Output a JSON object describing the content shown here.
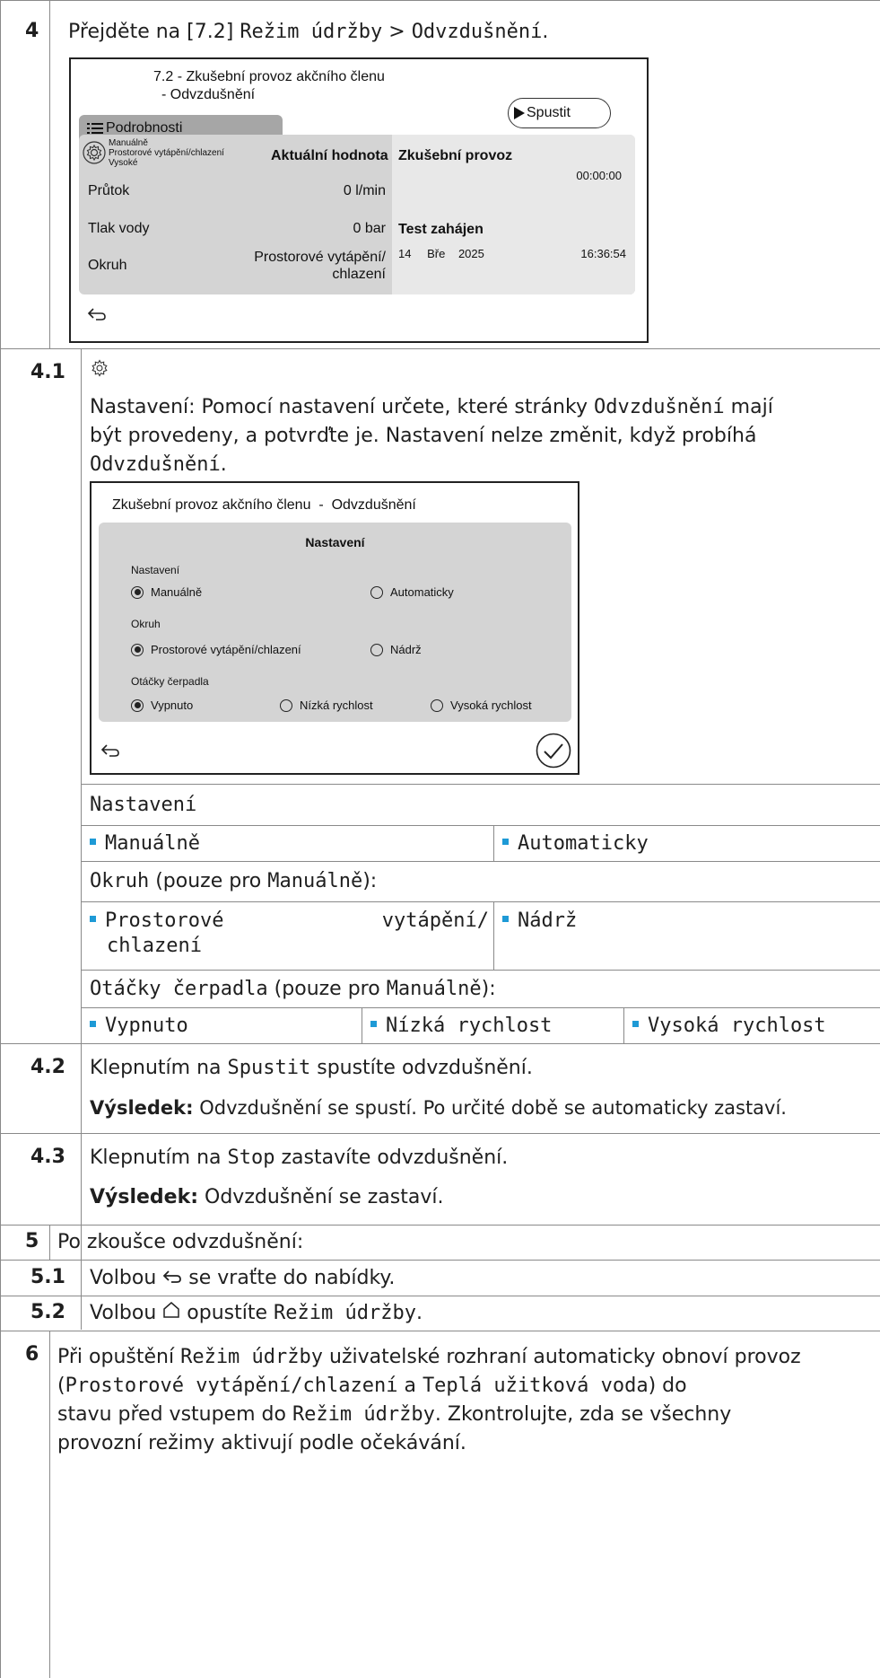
{
  "step4": {
    "num": "4",
    "pre": "Přejděte na [7.2] ",
    "menu": "Režim údržby",
    "sep": " > ",
    "sub": "Odvzdušnění",
    "end": ".",
    "screen": {
      "title1": "7.2 - Zkušební provoz akčního členu",
      "title2": "- Odvzdušnění",
      "details": "Podrobnosti",
      "start": "Spustit",
      "mode1": "Manuálně",
      "mode2": "Prostorové vytápění/chlazení",
      "mode3": "Vysoké",
      "col_current": "Aktuální hodnota",
      "col_test": "Zkušební provoz",
      "test_time": "00:00:00",
      "rows": [
        {
          "label": "Průtok",
          "value": "0 l/min"
        },
        {
          "label": "Tlak vody",
          "value": "0 bar"
        },
        {
          "label": "Okruh",
          "value1": "Prostorové vytápění/",
          "value2": "chlazení"
        }
      ],
      "started_label": "Test zahájen",
      "started_day": "14",
      "started_month": "Bře",
      "started_year": "2025",
      "started_time": "16:36:54"
    }
  },
  "step41": {
    "num": "4.1",
    "l1a": "Nastavení: Pomocí nastavení určete, které stránky ",
    "l1b": "Odvzdušnění",
    "l1c": " mají",
    "l2": "být provedeny, a potvrďte je. Nastavení nelze změnit, když probíhá",
    "l3a": "Odvzdušnění",
    "l3b": ".",
    "screen": {
      "title": "Zkušební provoz akčního členu  -  Odvzdušnění",
      "panel_title": "Nastavení",
      "g1_label": "Nastavení",
      "g1_opt1": "Manuálně",
      "g1_opt2": "Automaticky",
      "g2_label": "Okruh",
      "g2_opt1": "Prostorové vytápění/chlazení",
      "g2_opt2": "Nádrž",
      "g3_label": "Otáčky čerpadla",
      "g3_opt1": "Vypnuto",
      "g3_opt2": "Nízká rychlost",
      "g3_opt3": "Vysoká rychlost"
    },
    "table": {
      "h1": "Nastavení",
      "r1c1": "Manuálně",
      "r1c2": "Automaticky",
      "h2a": "Okruh",
      "h2b": " (pouze pro ",
      "h2c": "Manuálně",
      "h2d": "):",
      "r2c1a": "Prostorové",
      "r2c1b": "vytápění/",
      "r2c1c": "chlazení",
      "r2c2": "Nádrž",
      "h3a": "Otáčky čerpadla",
      "h3b": " (pouze pro ",
      "h3c": "Manuálně",
      "h3d": "):",
      "r3c1": "Vypnuto",
      "r3c2": "Nízká rychlost",
      "r3c3": "Vysoká rychlost"
    }
  },
  "step42": {
    "num": "4.2",
    "a": "Klepnutím na ",
    "b": "Spustit",
    "c": " spustíte odvzdušnění.",
    "res_label": "Výsledek:",
    "res": " Odvzdušnění se spustí. Po určité době se automaticky zastaví."
  },
  "step43": {
    "num": "4.3",
    "a": "Klepnutím na ",
    "b": "Stop",
    "c": " zastavíte odvzdušnění.",
    "res_label": "Výsledek:",
    "res": " Odvzdušnění se zastaví."
  },
  "step5": {
    "num": "5",
    "text": "Po zkoušce odvzdušnění:"
  },
  "step51": {
    "num": "5.1",
    "a": "Volbou ",
    "b": " se vraťte do nabídky."
  },
  "step52": {
    "num": "5.2",
    "a": "Volbou ",
    "b": " opustíte ",
    "c": "Režim údržby",
    "d": "."
  },
  "step6": {
    "num": "6",
    "l1a": "Při opuštění ",
    "l1b": "Režim údržby",
    "l1c": " uživatelské rozhraní automaticky obnoví provoz",
    "l2a": "(",
    "l2b": "Prostorové vytápění/chlazení",
    "l2c": " a ",
    "l2d": "Teplá užitková voda",
    "l2e": ") do",
    "l3a": "stavu před vstupem do ",
    "l3b": "Režim údržby",
    "l3c": ". Zkontrolujte, zda se všechny",
    "l4": "provozní režimy aktivují podle očekávání."
  },
  "colors": {
    "accent": "#1e9ad6",
    "panel": "#d4d4d4",
    "grid": "#8a8a8a"
  },
  "icons": [
    "gear-icon",
    "menu-icon",
    "play-icon",
    "back-arrow-icon",
    "check-icon",
    "home-icon"
  ]
}
